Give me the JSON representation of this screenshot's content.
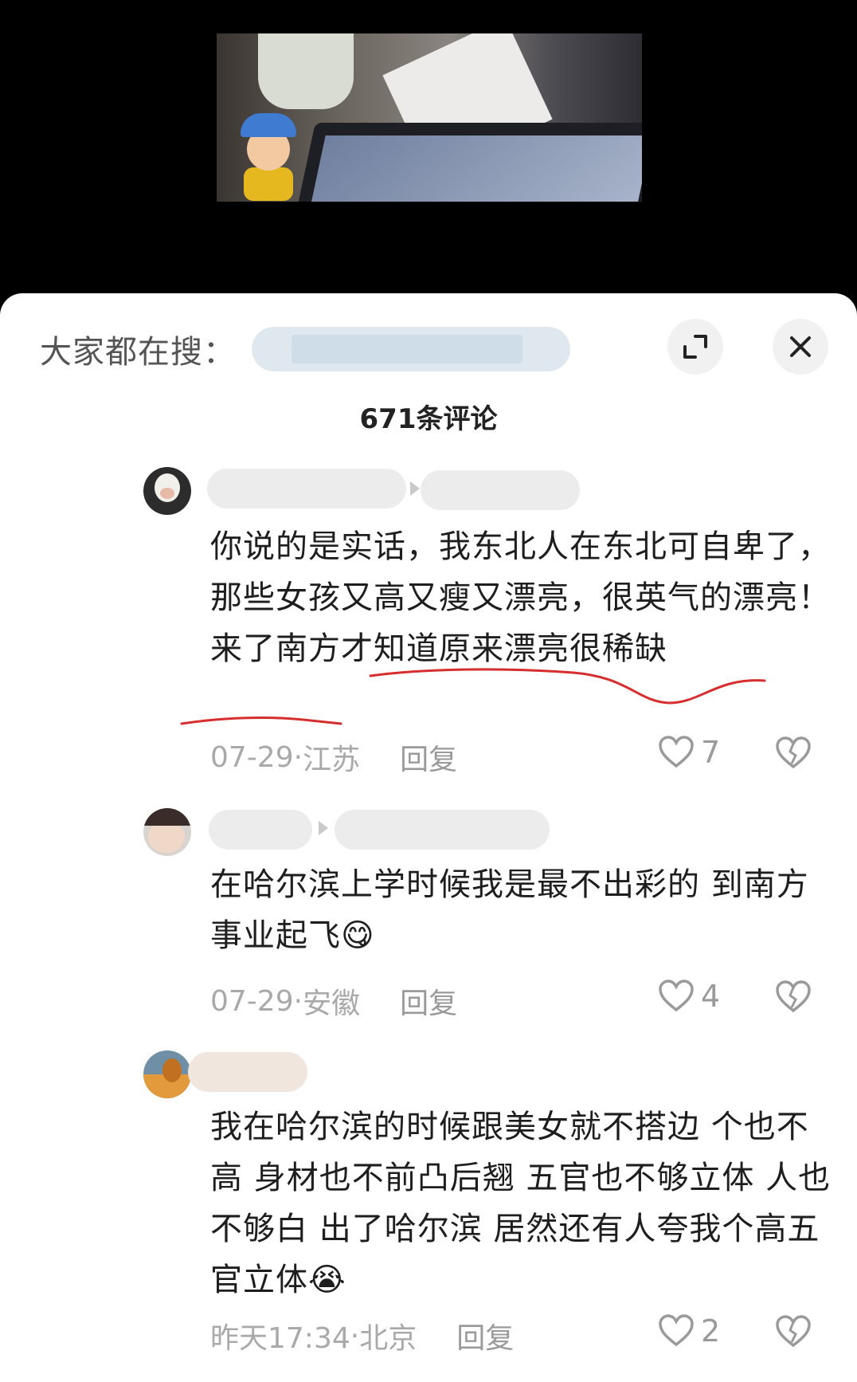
{
  "search": {
    "label": "大家都在搜："
  },
  "comments_header": {
    "count_text": "671条评论"
  },
  "comments": [
    {
      "text": "你说的是实话，我东北人在东北可自卑了，那些女孩又高又瘦又漂亮，很英气的漂亮！ 来了南方才知道原来漂亮很稀缺",
      "date": "07-29",
      "location": "江苏",
      "reply": "回复",
      "likes": "7"
    },
    {
      "text": "在哈尔滨上学时候我是最不出彩的  到南方事业起飞",
      "emoji": "😋",
      "date": "07-29",
      "location": "安徽",
      "reply": "回复",
      "likes": "4"
    },
    {
      "text": "我在哈尔滨的时候跟美女就不搭边 个也不高 身材也不前凸后翘 五官也不够立体 人也不够白 出了哈尔滨 居然还有人夸我个高五官立体",
      "emoji": "😭",
      "date": "昨天17:34",
      "location": "北京",
      "reply": "回复",
      "likes": "2"
    }
  ],
  "meta_separator": " · ",
  "icons": {
    "expand": "expand-icon",
    "close": "close-icon",
    "like": "heart-icon",
    "dislike": "broken-heart-icon"
  },
  "colors": {
    "annotation_underline": "#d62e2e",
    "muted_text": "#a9a9a9"
  }
}
